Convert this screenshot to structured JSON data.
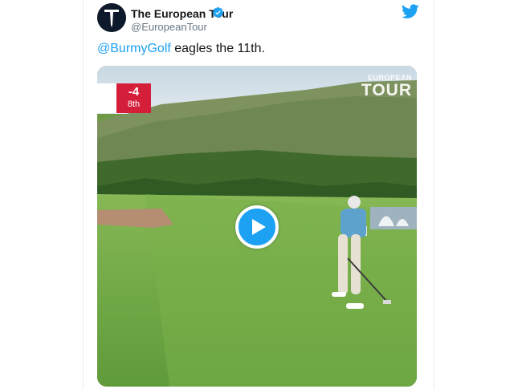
{
  "account": {
    "display_name": "The European Tour",
    "handle": "@EuropeanTour",
    "avatar_letter": "T"
  },
  "tweet": {
    "mention": "@BurmyGolf",
    "text": " eagles the 11th."
  },
  "video": {
    "score": "-4",
    "hole": "8th",
    "watermark_top": "EUROPEAN",
    "watermark_bottom": "TOUR"
  },
  "colors": {
    "twitter_blue": "#1da1f2",
    "score_red": "#d51e3a",
    "avatar_bg": "#0e1a2b"
  },
  "icons": [
    "verified-badge-icon",
    "twitter-bird-icon",
    "play-icon"
  ]
}
